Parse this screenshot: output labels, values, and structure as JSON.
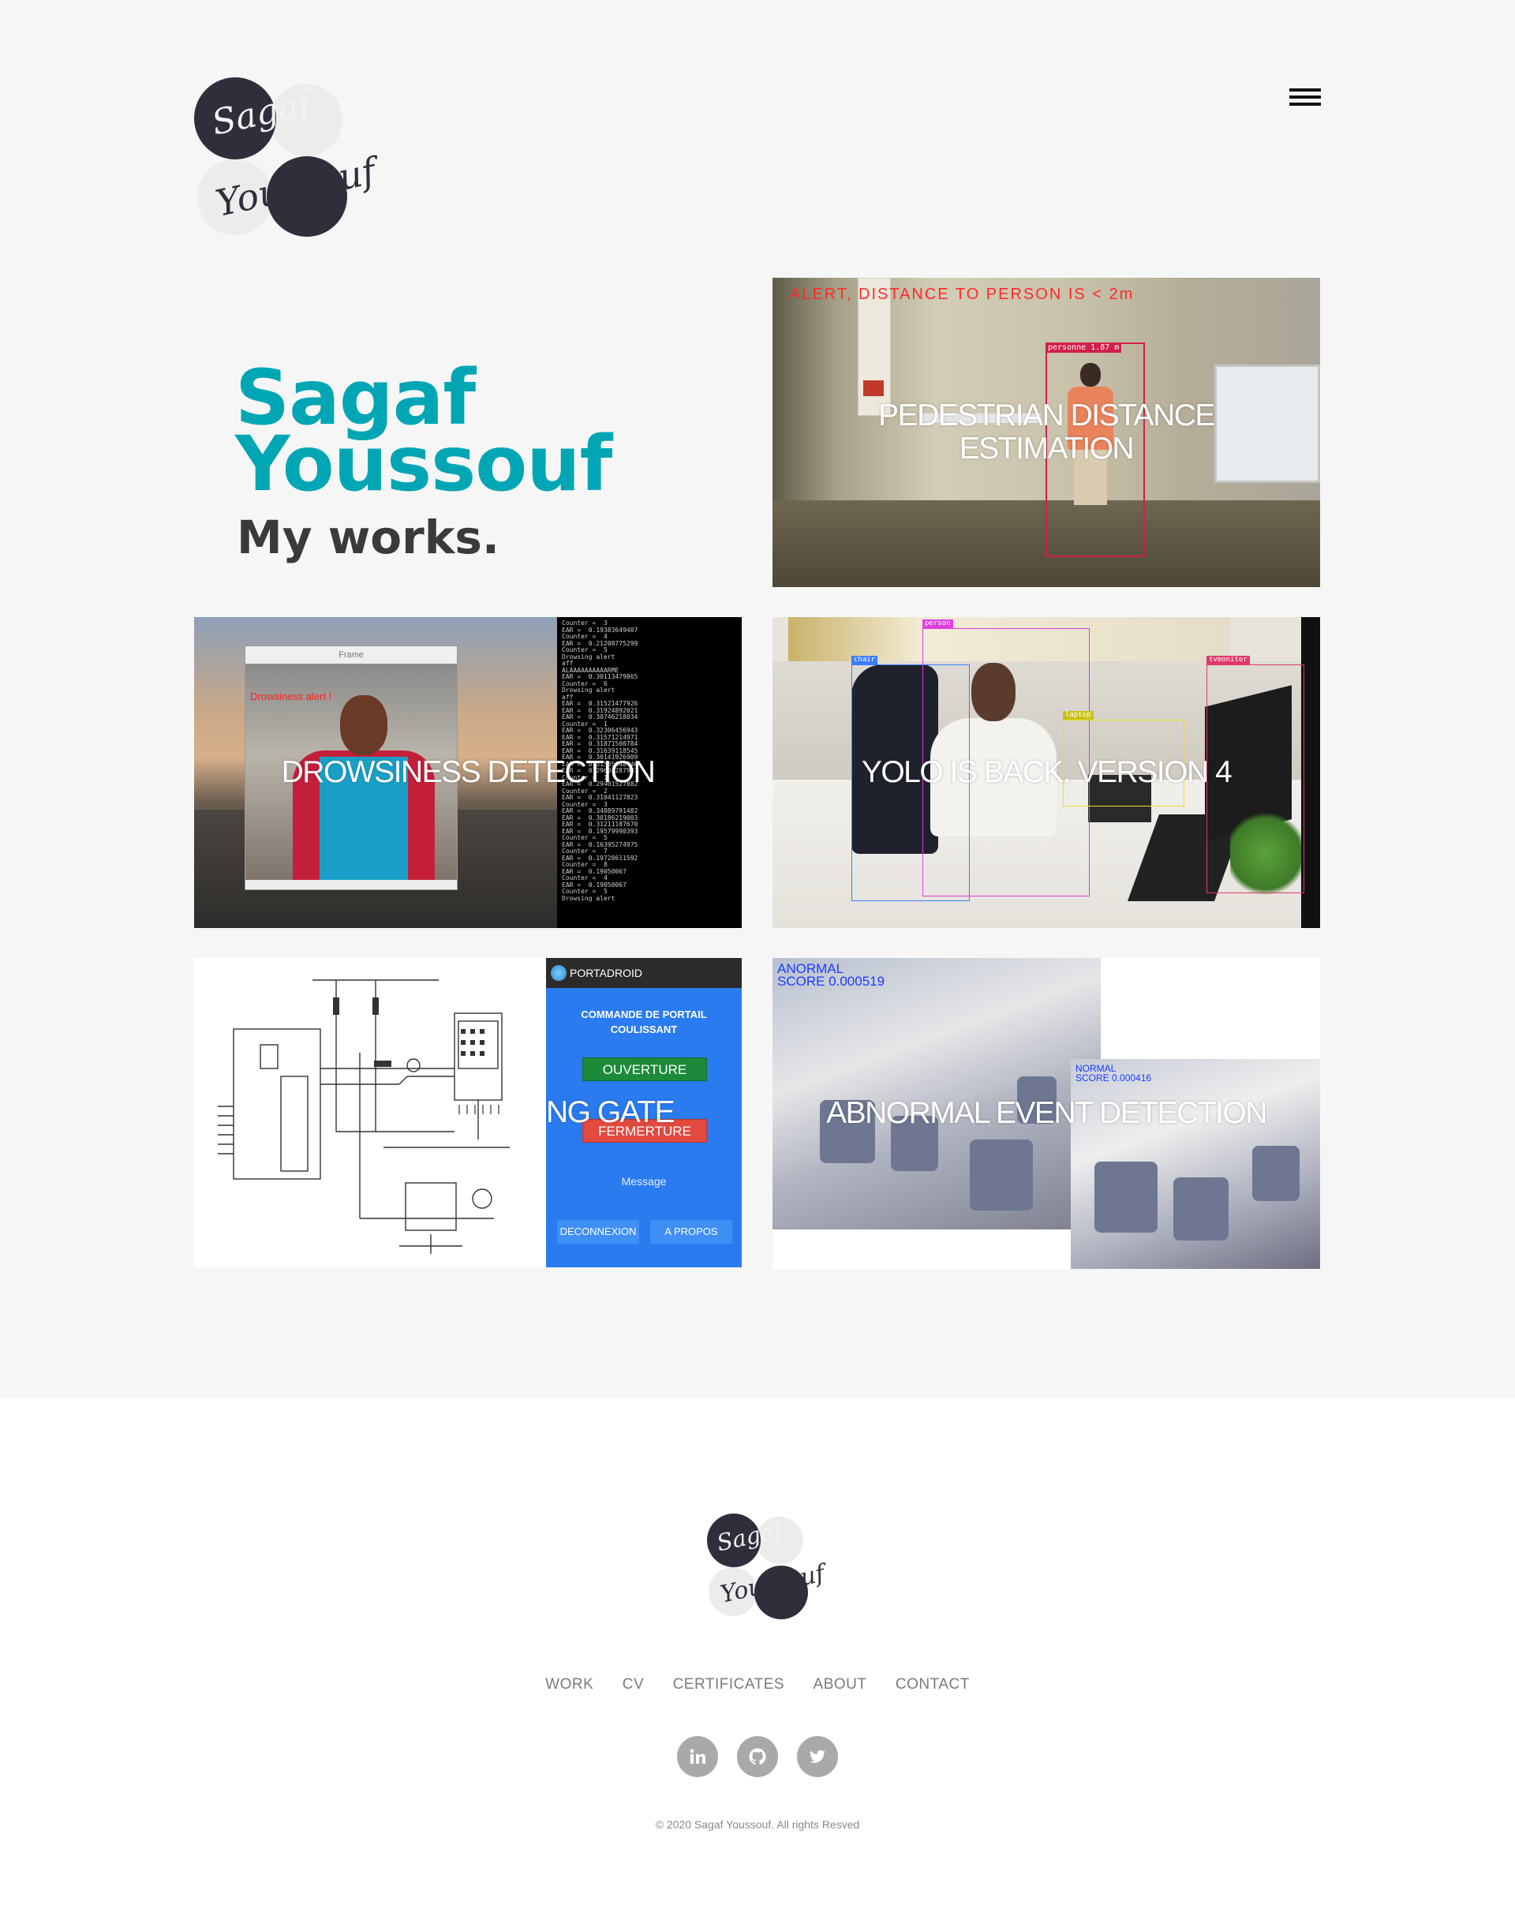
{
  "header": {
    "logo_line1": "Sagaf",
    "logo_line2": "Youssouf"
  },
  "hero": {
    "first_name": "Sagaf",
    "last_name": "Youssouf",
    "subtitle": "My works."
  },
  "works": [
    {
      "title": "PEDESTRIAN DISTANCE ESTIMATION",
      "overlay_text": "ALERT, DISTANCE TO PERSON IS < 2m",
      "tag": "personne 1.87 m"
    },
    {
      "title": "DROWSINESS DETECTION",
      "frame_title": "Frame",
      "alert_text": "Drowsiness alert !"
    },
    {
      "title": "YOLO IS BACK, VERSION 4",
      "labels": [
        "person",
        "chair",
        "tvmonitor",
        "laptop"
      ]
    },
    {
      "title": "SMART SLIDING GATE",
      "visible_caption": "NG GATE",
      "app_name": "PORTADROID",
      "app_heading": "COMMANDE DE PORTAIL COULISSANT",
      "open_button": "OUVERTURE",
      "close_button": "FERMERTURE",
      "message_label": "Message",
      "disconnect_button": "DECONNEXION",
      "about_button": "A PROPOS"
    },
    {
      "title": "ABNORMAL EVENT DETECTION",
      "label_1": "ANORMAL",
      "score_1": "SCORE 0.000519",
      "label_2": "NORMAL",
      "score_2": "SCORE 0.000416"
    }
  ],
  "footer": {
    "nav": [
      "WORK",
      "CV",
      "CERTIFICATES",
      "ABOUT",
      "CONTACT"
    ],
    "social": [
      "linkedin-icon",
      "github-icon",
      "twitter-icon"
    ],
    "copyright": "© 2020 Sagaf Youssouf. All rights Resved"
  },
  "colors": {
    "accent": "#00a6b4",
    "dark": "#2f2e3b",
    "page_bg": "#f6f6f6"
  }
}
